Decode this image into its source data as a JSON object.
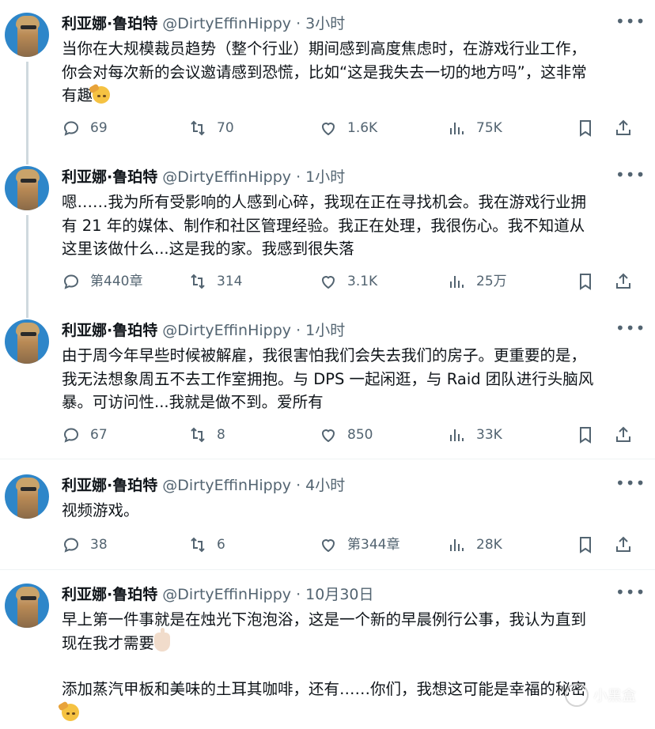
{
  "author": {
    "name": "利亚娜·鲁珀特",
    "handle": "@DirtyEffinHippy"
  },
  "tweets": [
    {
      "time": "3小时",
      "lines": [
        "当你在大规模裁员趋势（整个行业）期间感到高度焦虑时，在游戏行业工作，",
        "你会对每次新的会议邀请感到恐慌，比如“这是我失去一切的地方吗”，这非常",
        "有趣"
      ],
      "replies": "69",
      "reposts": "70",
      "likes": "1.6K",
      "views": "75K"
    },
    {
      "time": "1小时",
      "lines": [
        "嗯……我为所有受影响的人感到心碎，我现在正在寻找机会。我在游戏行业拥",
        "有 21 年的媒体、制作和社区管理经验。我正在处理，我很伤心。我不知道从",
        "这里该做什么...这是我的家。我感到很失落"
      ],
      "replies": "第440章",
      "reposts": "314",
      "likes": "3.1K",
      "views": "25万"
    },
    {
      "time": "1小时",
      "lines": [
        "由于周今年早些时候被解雇，我很害怕我们会失去我们的房子。更重要的是，",
        "我无法想象周五不去工作室拥抱。与 DPS 一起闲逛，与 Raid 团队进行头脑风",
        "暴。可访问性...我就是做不到。爱所有"
      ],
      "replies": "67",
      "reposts": "8",
      "likes": "850",
      "views": "33K"
    },
    {
      "time": "4小时",
      "lines": [
        "视频游戏。"
      ],
      "replies": "38",
      "reposts": "6",
      "likes": "第344章",
      "views": "28K"
    },
    {
      "time": "10月30日",
      "lines": [
        "早上第一件事就是在烛光下泡泡浴，这是一个新的早晨例行公事，我认为直到",
        "现在我才需要"
      ],
      "lines2": [
        "添加蒸汽甲板和美味的土耳其咖啡，还有……你们，我想这可能是幸福的秘密"
      ]
    }
  ],
  "separator": " · ",
  "more_glyph": "•••",
  "watermark": "小黑盒",
  "icons": {
    "reply": "reply-icon",
    "repost": "repost-icon",
    "like": "heart-icon",
    "views": "views-icon",
    "bookmark": "bookmark-icon",
    "share": "share-icon"
  }
}
